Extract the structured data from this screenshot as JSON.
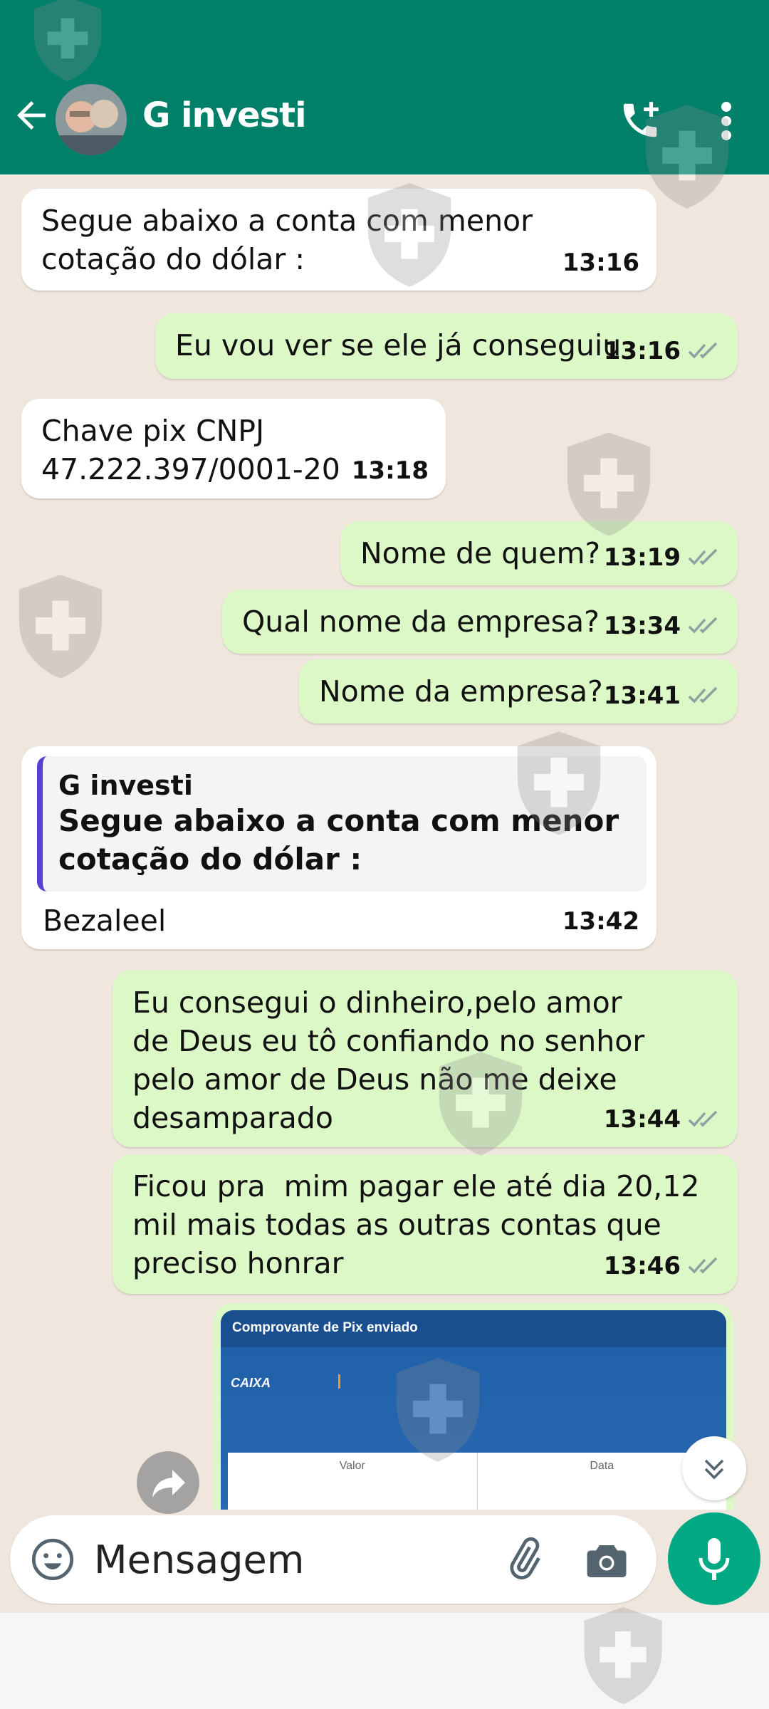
{
  "header": {
    "title": "G investi",
    "back_icon": "arrow-left-icon",
    "call_icon": "add-call-icon",
    "menu_icon": "more-vert-icon",
    "color": "#008069"
  },
  "messages": [
    {
      "dir": "in",
      "text": "Segue abaixo a conta com menor\ncotação do dólar :",
      "time": "13:16"
    },
    {
      "dir": "out",
      "text": "Eu vou ver se ele já conseguiu",
      "time": "13:16"
    },
    {
      "dir": "in",
      "text": "Chave pix CNPJ\n47.222.397/0001-20",
      "time": "13:18"
    },
    {
      "dir": "out",
      "text": "Nome de quem?",
      "time": "13:19"
    },
    {
      "dir": "out",
      "text": "Qual nome da empresa?",
      "time": "13:34"
    },
    {
      "dir": "out",
      "text": "Nome da empresa?",
      "time": "13:41"
    },
    {
      "dir": "in",
      "reply_author": "G investi",
      "reply_text": "Segue abaixo a conta com menor\ncotação do dólar :",
      "text": "Bezaleel",
      "time": "13:42"
    },
    {
      "dir": "out",
      "text": "Eu consegui o dinheiro,pelo amor\nde Deus eu tô confiando no senhor\npelo amor de Deus não me deixe\ndesamparado",
      "time": "13:44"
    },
    {
      "dir": "out",
      "text": "Ficou pra  mim pagar ele até dia 20,12\nmil mais todas as outras contas que\npreciso honrar",
      "time": "13:46"
    }
  ],
  "pix_receipt": {
    "header": "Comprovante de Pix enviado",
    "logo": "CAIXA",
    "col_value": "Valor",
    "col_date": "Data"
  },
  "input": {
    "placeholder": "Mensagem"
  },
  "colors": {
    "incoming": "#ffffff",
    "outgoing": "#dcf8c6",
    "mic": "#00a884",
    "read_ticks": "#8aa3a0"
  }
}
